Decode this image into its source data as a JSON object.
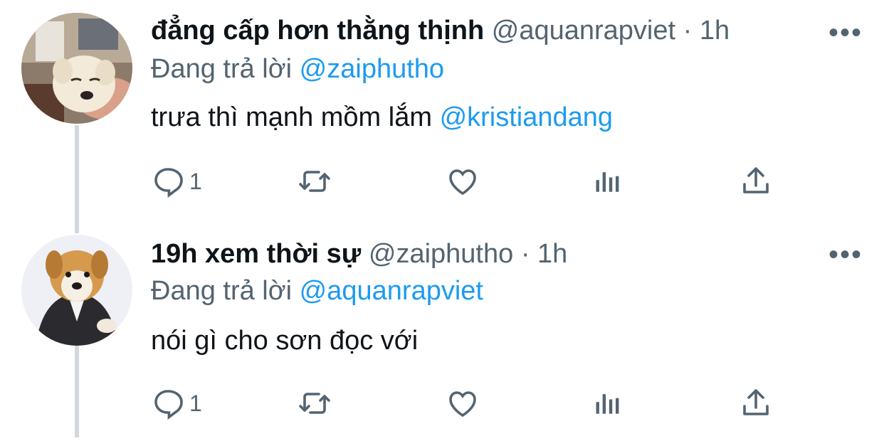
{
  "tweets": [
    {
      "display_name": "đẳng cấp hơn thằng thịnh",
      "handle": "@aquanrapviet",
      "separator": "·",
      "time": "1h",
      "more": "•••",
      "reply_prefix": "Đang trả lời",
      "reply_to": "@zaiphutho",
      "text": "trưa thì mạnh mồm lắm",
      "mention": "@kristiandang",
      "reply_count": "1",
      "avatar": "puppy-face-avatar"
    },
    {
      "display_name": "19h xem thời sự",
      "handle": "@zaiphutho",
      "separator": "·",
      "time": "1h",
      "more": "•••",
      "reply_prefix": "Đang trả lời",
      "reply_to": "@aquanrapviet",
      "text": "nói gì cho sơn đọc với",
      "mention": "",
      "reply_count": "1",
      "avatar": "dog-in-suit-avatar"
    }
  ],
  "icons": [
    "reply-icon",
    "retweet-icon",
    "like-icon",
    "views-icon",
    "share-icon",
    "more-icon"
  ],
  "colors": {
    "link": "#1d9bf0",
    "secondary": "#536471",
    "thread_line": "#cfd9de"
  }
}
